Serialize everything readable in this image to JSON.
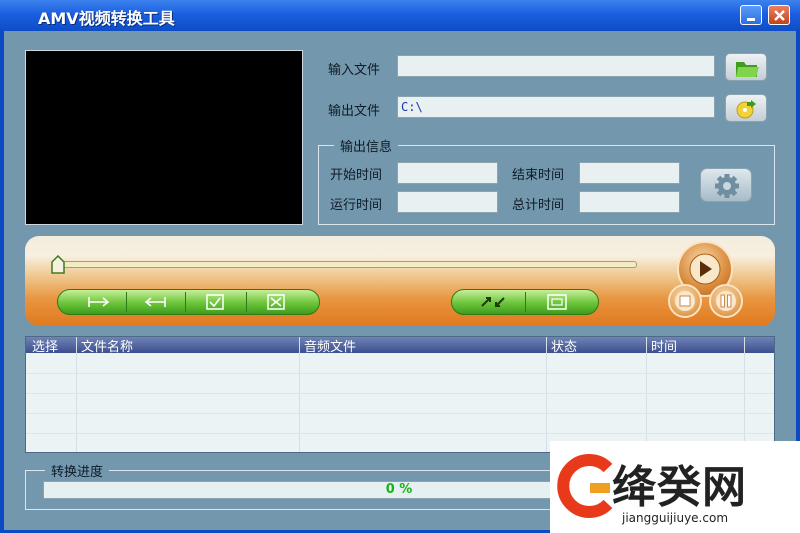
{
  "window": {
    "title": "AMV视频转换工具",
    "minimize_icon": "minimize-icon",
    "close_icon": "close-icon"
  },
  "files": {
    "input_label": "输入文件",
    "input_value": "",
    "input_icon": "open-folder-icon",
    "output_label": "输出文件",
    "output_value": "C:\\",
    "output_icon": "output-folder-icon"
  },
  "output_info": {
    "group_title": "输出信息",
    "start_time_label": "开始时间",
    "start_time_value": "",
    "end_time_label": "结束时间",
    "end_time_value": "",
    "run_time_label": "运行时间",
    "run_time_value": "",
    "total_time_label": "总计时间",
    "total_time_value": "",
    "settings_icon": "gear-icon"
  },
  "player": {
    "seek_position": 0,
    "left_buttons": [
      "mark-in-icon",
      "mark-out-icon",
      "check-all-icon",
      "uncheck-all-icon"
    ],
    "right_buttons": [
      "convert-icon",
      "fullscreen-icon"
    ],
    "play_icon": "play-icon",
    "stop_icon": "stop-icon",
    "pause_icon": "pause-icon"
  },
  "file_list": {
    "columns": [
      "选择",
      "文件名称",
      "音频文件",
      "状态",
      "时间"
    ],
    "rows": []
  },
  "progress": {
    "group_title": "转换进度",
    "percent": 0,
    "text": "0 %"
  },
  "watermark": {
    "brand": "绛癸网",
    "url": "jiangguijiuye.com",
    "logo_icon": "brand-logo-icon"
  },
  "colors": {
    "titlebar": "#1b5fe0",
    "window_bg": "#7398ad",
    "player_orange": "#e07a1e",
    "button_green": "#6bc53a",
    "progress_text": "#18b418"
  }
}
